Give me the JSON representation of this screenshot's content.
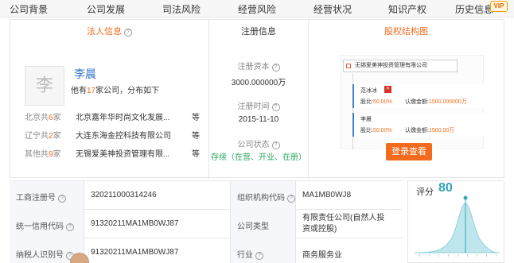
{
  "nav": {
    "items": [
      "公司背景",
      "公司发展",
      "司法风险",
      "经营风险",
      "经营状况",
      "知识产权",
      "历史信息"
    ],
    "vip": "VIP"
  },
  "legal_person": {
    "header": "法人信息",
    "avatar_char": "李",
    "name": "李晨",
    "summary_prefix": "他有",
    "summary_count": "17",
    "summary_suffix": "家公司，分布如下",
    "related": [
      {
        "city": "北京",
        "count_prefix": "共",
        "count": "6",
        "count_suffix": "家",
        "company": "北京嘉年华时尚文化发展...",
        "more": "等"
      },
      {
        "city": "辽宁",
        "count_prefix": "共",
        "count": "2",
        "count_suffix": "家",
        "company": "大连东海金控科技有限公司",
        "more": "等"
      },
      {
        "city": "其他",
        "count_prefix": "共",
        "count": "9",
        "count_suffix": "家",
        "company": "无锡爱美神投资管理有限...",
        "more": "等"
      }
    ]
  },
  "registration": {
    "header": "注册信息",
    "capital_label": "注册资本",
    "capital_value": "3000.000000万",
    "date_label": "注册时间",
    "date_value": "2015-11-10",
    "status_label": "公司状态",
    "status_value": "存续（在营、开业、在册）"
  },
  "equity": {
    "header": "股权结构图",
    "company": "无锡爱美神投资管理有限公司",
    "holders": [
      {
        "name": "范冰冰",
        "ratio_label": "股比:",
        "ratio": "50.00%",
        "amount_label": "认缴金额:",
        "amount": "1500.000000万"
      },
      {
        "name": "李晨",
        "ratio_label": "股比:",
        "ratio": "50.00%",
        "amount_label": "认缴金额:",
        "amount": "1500.00万"
      }
    ],
    "login_button": "登录查看"
  },
  "table": {
    "rows": [
      [
        {
          "label": "工商注册号",
          "value": "320211000314246"
        },
        {
          "label": "组织机构代码",
          "value": "MA1MB0WJ8"
        }
      ],
      [
        {
          "label": "统一信用代码",
          "value": "91320211MA1MB0WJ87"
        },
        {
          "label": "公司类型",
          "value": "有限责任公司(自然人投资或控股)"
        }
      ],
      [
        {
          "label": "纳税人识别号",
          "value": "91320211MA1MB0WJ87"
        },
        {
          "label": "行业",
          "value": "商务服务业"
        }
      ]
    ]
  },
  "score": {
    "label": "评分",
    "value": "80"
  },
  "colors": {
    "accent_orange": "#f26b1d",
    "link_blue": "#3072c8",
    "status_green": "#26a65b",
    "score_teal": "#2fa5b5"
  }
}
